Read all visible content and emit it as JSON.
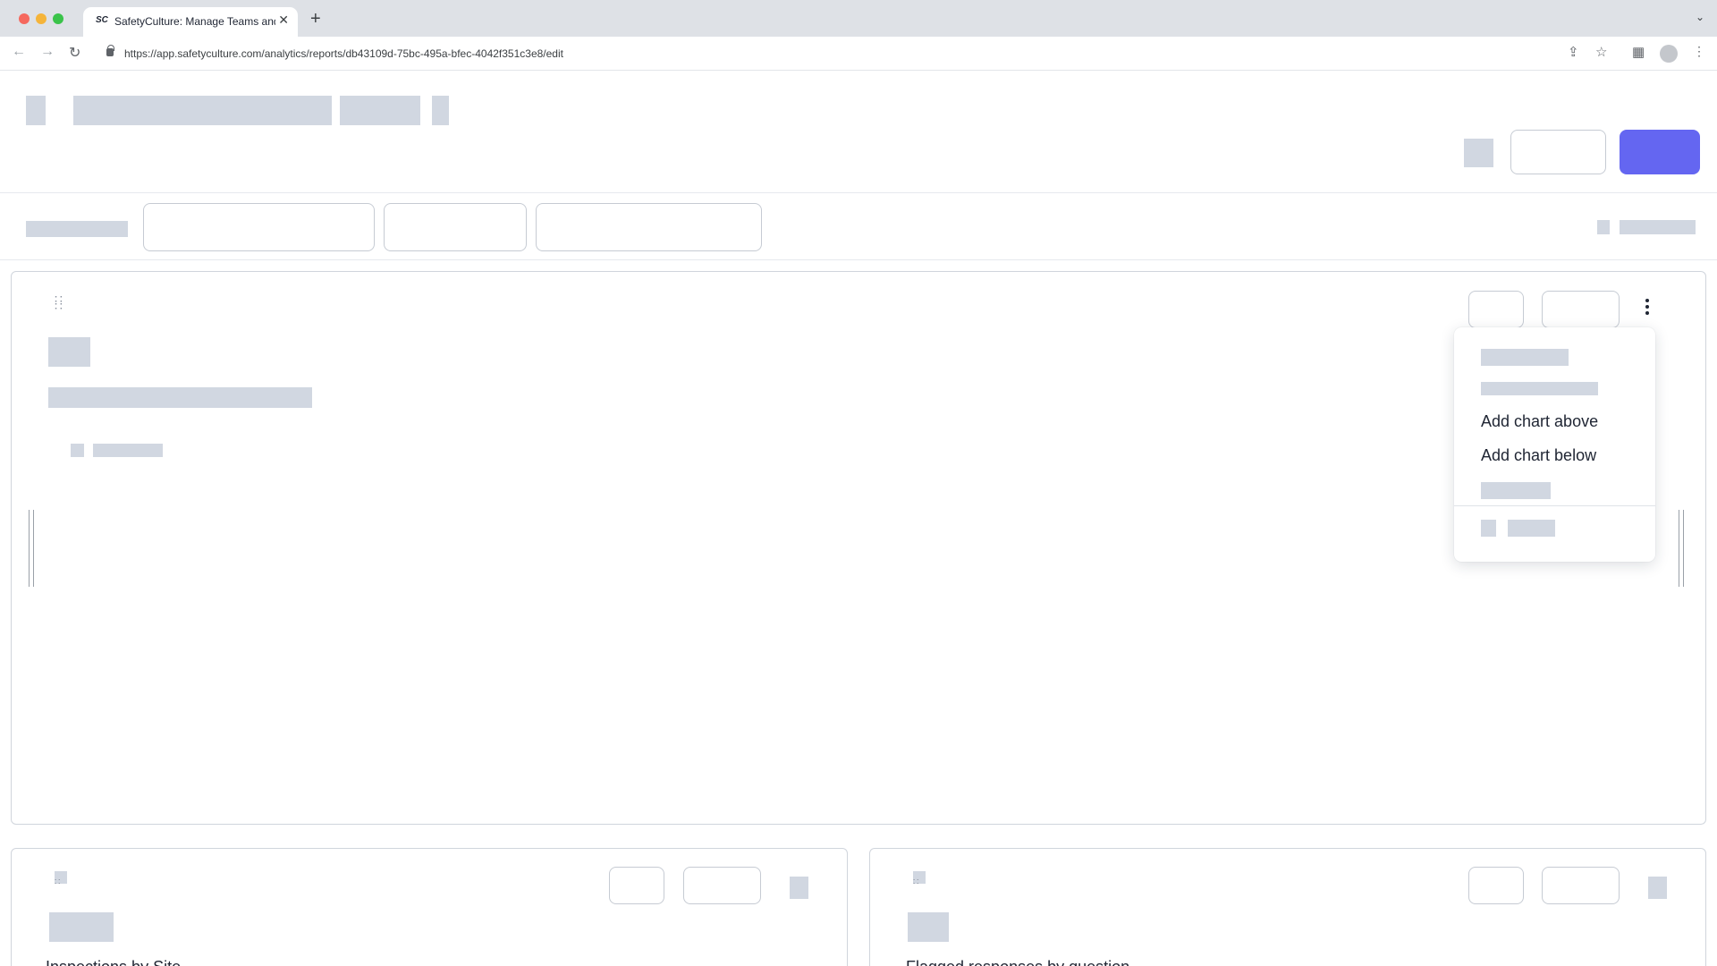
{
  "browser": {
    "tab_favicon": "SC",
    "tab_title": "SafetyCulture: Manage Teams and ...",
    "new_tab_glyph": "+",
    "close_tab_glyph": "✕",
    "url": "https://app.safetyculture.com/analytics/reports/db43109d-75bc-495a-bfec-4042f351c3e8/edit",
    "icons": [
      "back-icon",
      "forward-icon",
      "reload-icon",
      "lock-icon",
      "share-icon",
      "star-icon",
      "extensions-icon",
      "profile-icon",
      "menu-icon"
    ]
  },
  "colors": {
    "primary_button": "#6466f1",
    "skeleton": "#d1d7e1",
    "tab_bar": "#dee1e6"
  },
  "chart_menu": {
    "items": [
      {
        "label": "Add chart above"
      },
      {
        "label": "Add chart below"
      }
    ]
  },
  "cards_below": {
    "left_title_partial": "Inspections by Site",
    "right_title_partial": "Flagged responses by question"
  }
}
